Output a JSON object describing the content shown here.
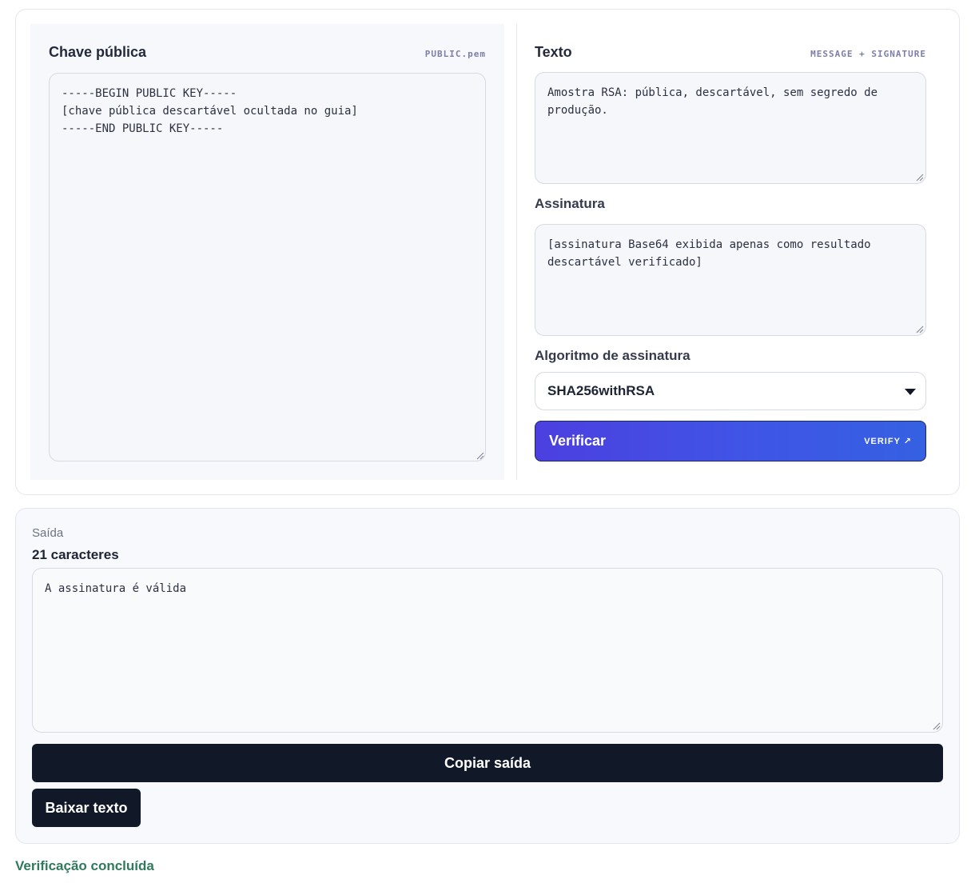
{
  "public_key": {
    "title": "Chave pública",
    "tag": "PUBLIC.pem",
    "value": "-----BEGIN PUBLIC KEY-----\n[chave pública descartável ocultada no guia]\n-----END PUBLIC KEY-----"
  },
  "text": {
    "title": "Texto",
    "tag": "MESSAGE + SIGNATURE",
    "value": "Amostra RSA: pública, descartável, sem segredo de\nprodução."
  },
  "signature": {
    "label": "Assinatura",
    "value": "[assinatura Base64 exibida apenas como resultado\ndescartável verificado]"
  },
  "algorithm": {
    "label": "Algoritmo de assinatura",
    "selected": "SHA256withRSA"
  },
  "verify_button": {
    "label": "Verificar",
    "tag": "VERIFY ↗"
  },
  "output": {
    "label": "Saída",
    "count": "21 caracteres",
    "value": "A assinatura é válida",
    "copy_label": "Copiar saída",
    "download_label": "Baixar texto"
  },
  "status": "Verificação concluída"
}
